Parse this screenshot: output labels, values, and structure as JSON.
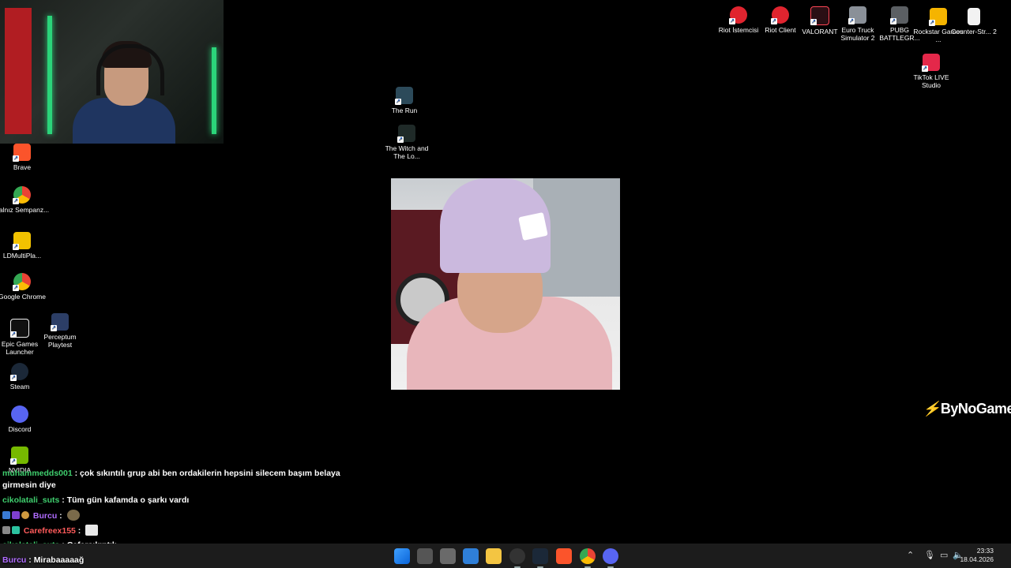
{
  "desktop_icons": {
    "riot_istemcisi": "Riot İstemcisi",
    "riot_client": "Riot Client",
    "valorant": "VALORANT",
    "euro_truck": "Euro Truck Simulator 2",
    "pubg": "PUBG BATTLEGR...",
    "rockstar": "Rockstar Games ...",
    "counter_strike": "Counter-Str... 2",
    "tiktok_live": "TikTok LIVE Studio",
    "the_run": "The Run",
    "the_witch": "The Witch and The Lo...",
    "brave": "Brave",
    "yalniz": "Yalnız Sempanz...",
    "ldmulti": "LDMultiPla...",
    "google_chrome": "Google Chrome",
    "epic": "Epic Games Launcher",
    "perceptum": "Perceptum Playtest",
    "steam": "Steam",
    "discord": "Discord",
    "nvidia": "NVIDIA"
  },
  "overlay": {
    "brand": "ByNoGame"
  },
  "chat": [
    {
      "user": "muhammedds001",
      "text": "çok sıkıntılı grup abi ben ordakilerin hepsini silecem başım belaya",
      "cont": "girmesin diye",
      "color": "#3fcf6e"
    },
    {
      "user": "cikolatali_suts",
      "text": "Tüm gün kafamda o şarkı vardı",
      "color": "#3fcf6e"
    },
    {
      "user": "Burcu",
      "text": "",
      "color": "#b06cff"
    },
    {
      "user": "Carefreex155",
      "text": "",
      "color": "#ff5b5b"
    },
    {
      "user": "cikolatali_suts",
      "text": "Cafersıkıntılı",
      "color": "#3fcf6e"
    },
    {
      "user": "Burcu",
      "text": "Mirabaaaaağ",
      "color": "#b06cff"
    }
  ],
  "taskbar": {
    "time": "23:33",
    "date": "18.04.2026"
  },
  "colors": {
    "taskbar_bg": "#1c1c1c",
    "desktop_bg": "#000000",
    "brand_accent": "#ff3b30"
  }
}
